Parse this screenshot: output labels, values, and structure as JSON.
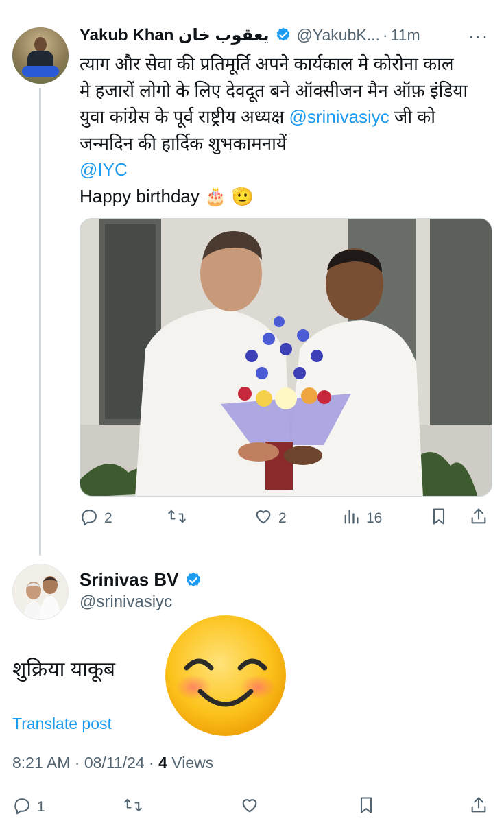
{
  "parent": {
    "name": "Yakub Khan يعقوب خان",
    "handle": "@YakubK...",
    "separator": "·",
    "time": "11m",
    "more": "···",
    "text_lines": [
      "त्याग और सेवा की प्रतिमूर्ति अपने कार्यकाल मे कोरोना काल",
      "मे हजारों लोगो के लिए देवदूत बने ऑक्सीजन मैन ऑफ़ इंडिया",
      "युवा कांग्रेस के पूर्व राष्ट्रीय अध्यक्ष"
    ],
    "mention_inline": "@srinivasiyc",
    "line3_tail": " जी को",
    "line4": "जन्मदिन की हार्दिक शुभकामनायें",
    "mention_iyc": "@IYC",
    "happy": "Happy birthday 🎂 🫡",
    "actions": {
      "replies": "2",
      "retweets": "",
      "likes": "2",
      "views": "16"
    }
  },
  "reply": {
    "name": "Srinivas BV",
    "handle": "@srinivasiyc",
    "text": "शुक्रिया याकूब",
    "translate": "Translate post",
    "time": "8:21 AM · 08/11/24 · ",
    "views_count": "4",
    "views_label": " Views",
    "actions": {
      "replies": "1"
    }
  },
  "colors": {
    "link": "#1d9bf0",
    "secondary": "#536471",
    "verified": "#1d9bf0"
  },
  "icons": [
    "reply-icon",
    "retweet-icon",
    "like-icon",
    "views-icon",
    "bookmark-icon",
    "share-icon",
    "verified-icon",
    "more-icon"
  ]
}
